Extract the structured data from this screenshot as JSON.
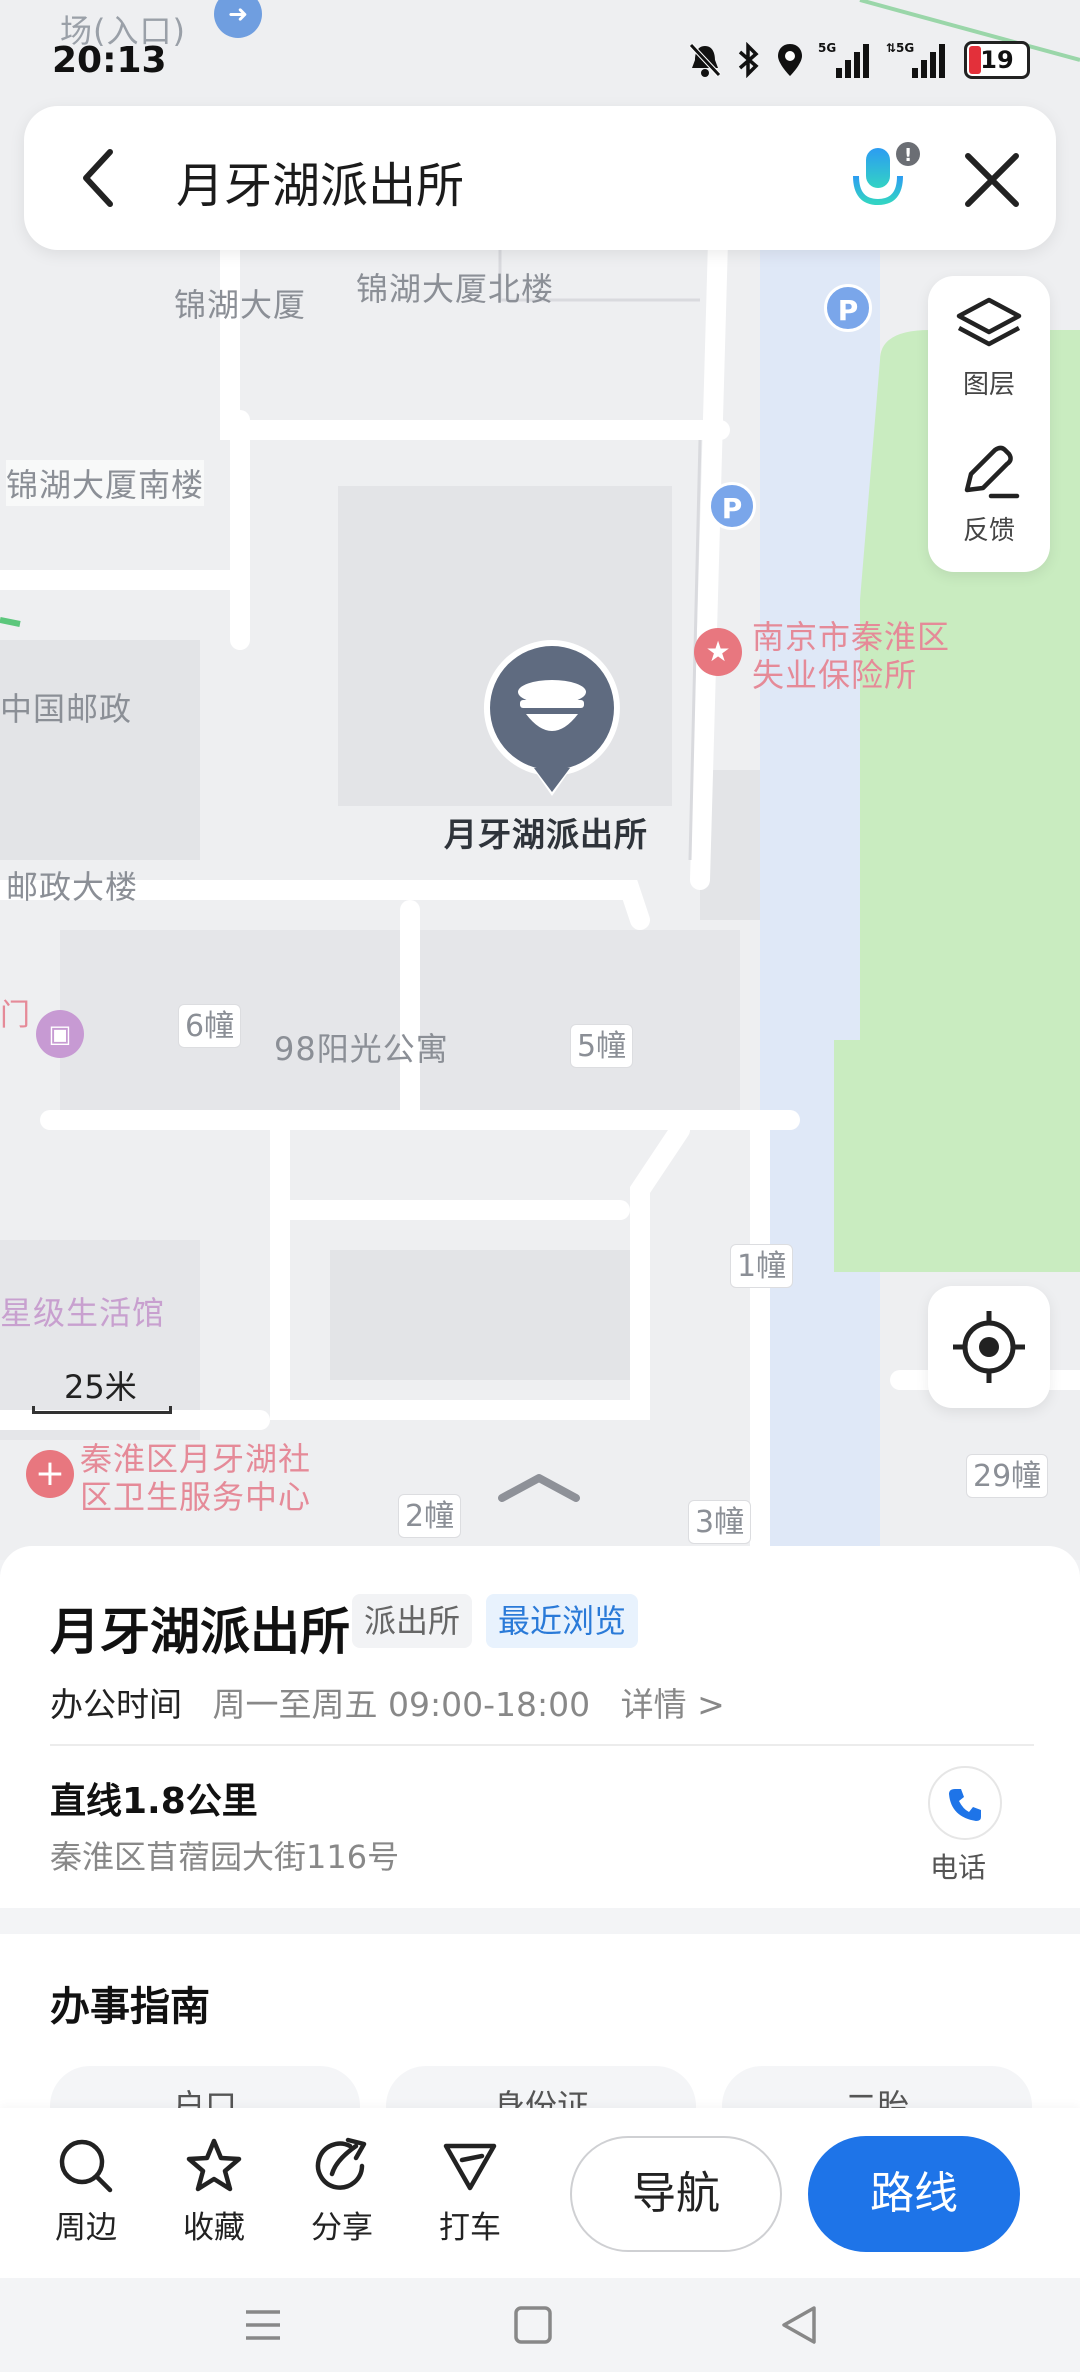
{
  "status_bar": {
    "time": "20:13",
    "battery": "19",
    "net1": "5G",
    "net2": "5G"
  },
  "search": {
    "query": "月牙湖派出所"
  },
  "map": {
    "top_fragment": "场(入口)",
    "labels": {
      "jinhu_building": "锦湖大厦",
      "jinhu_north": "锦湖大厦北楼",
      "jinhu_south": "锦湖大厦南楼",
      "china_post": "中国邮政",
      "post_building": "邮政大楼",
      "unemployment_line1": "南京市秦淮区",
      "unemployment_line2": "失业保险所",
      "police_station": "月牙湖派出所",
      "sunshine_apartment": "98阳光公寓",
      "star_life_hall": "星级生活馆",
      "clinic_line1": "秦淮区月牙湖社",
      "clinic_line2": "区卫生服务中心",
      "door_fragment": "门",
      "bldg_6": "6幢",
      "bldg_5": "5幢",
      "bldg_1": "1幢",
      "bldg_2": "2幢",
      "bldg_3": "3幢",
      "bldg_29": "29幢"
    },
    "parking": "P",
    "scale": "25米"
  },
  "map_controls": {
    "layers": "图层",
    "feedback": "反馈"
  },
  "place": {
    "name": "月牙湖派出所",
    "category_tag": "派出所",
    "recent_tag": "最近浏览",
    "hours_label": "办公时间",
    "hours_value": "周一至周五 09:00-18:00",
    "details": "详情 >",
    "distance": "直线1.8公里",
    "address": "秦淮区苜蓿园大街116号",
    "phone_label": "电话"
  },
  "guide": {
    "heading": "办事指南",
    "pills": [
      "户口",
      "身份证",
      "二胎"
    ]
  },
  "actions": {
    "nearby": "周边",
    "favorite": "收藏",
    "share": "分享",
    "taxi": "打车",
    "navigate": "导航",
    "route": "路线"
  },
  "colors": {
    "accent": "#1e74e8",
    "park_green": "#c9ecc0",
    "poi_red": "#e8777f"
  }
}
